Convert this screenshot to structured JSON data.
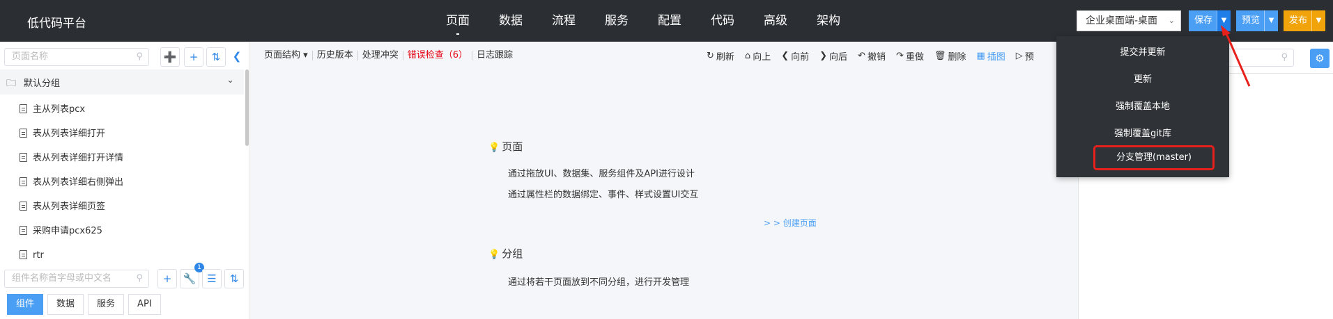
{
  "app": {
    "brand": "低代码平台"
  },
  "nav": {
    "items": [
      {
        "label": "页面",
        "active": true
      },
      {
        "label": "数据",
        "active": false
      },
      {
        "label": "流程",
        "active": false
      },
      {
        "label": "服务",
        "active": false
      },
      {
        "label": "配置",
        "active": false
      },
      {
        "label": "代码",
        "active": false
      },
      {
        "label": "高级",
        "active": false
      },
      {
        "label": "架构",
        "active": false
      }
    ]
  },
  "header": {
    "env_select": "企业桌面端-桌面",
    "save_label": "保存",
    "preview_label": "预览",
    "publish_label": "发布"
  },
  "left": {
    "page_search_placeholder": "页面名称",
    "group_label": "默认分组",
    "pages": [
      "主从列表pcx",
      "表从列表详细打开",
      "表从列表详细打开详情",
      "表从列表详细右侧弹出",
      "表从列表详细页签",
      "采购申请pcx625",
      "rtr"
    ],
    "component_search_placeholder": "组件名称首字母或中文名",
    "badge_count": "1",
    "tabs": [
      {
        "label": "组件",
        "active": true
      },
      {
        "label": "数据",
        "active": false
      },
      {
        "label": "服务",
        "active": false
      },
      {
        "label": "API",
        "active": false
      }
    ]
  },
  "toolbar": {
    "left": [
      "页面结构",
      "历史版本",
      "处理冲突",
      "错误检查（6）",
      "日志跟踪"
    ],
    "right": [
      "刷新",
      "向上",
      "向前",
      "向后",
      "撤销",
      "重做",
      "删除",
      "插图",
      "预"
    ]
  },
  "guide": {
    "page_title": "页面",
    "page_line1": "通过拖放UI、数据集、服务组件及API进行设计",
    "page_line2": "通过属性栏的数据绑定、事件、样式设置UI交互",
    "create_page_link": "> > 创建页面",
    "group_title": "分组",
    "group_line1": "通过将若干页面放到不同分组，进行开发管理"
  },
  "save_menu": {
    "items": [
      "提交并更新",
      "更新",
      "强制覆盖本地",
      "强制覆盖git库",
      "分支管理(master)"
    ]
  },
  "colors": {
    "topbar": "#2b2e33",
    "accent": "#4a9ff5",
    "publish": "#f0a30a",
    "error": "#e60012",
    "highlight": "#e8201c"
  }
}
